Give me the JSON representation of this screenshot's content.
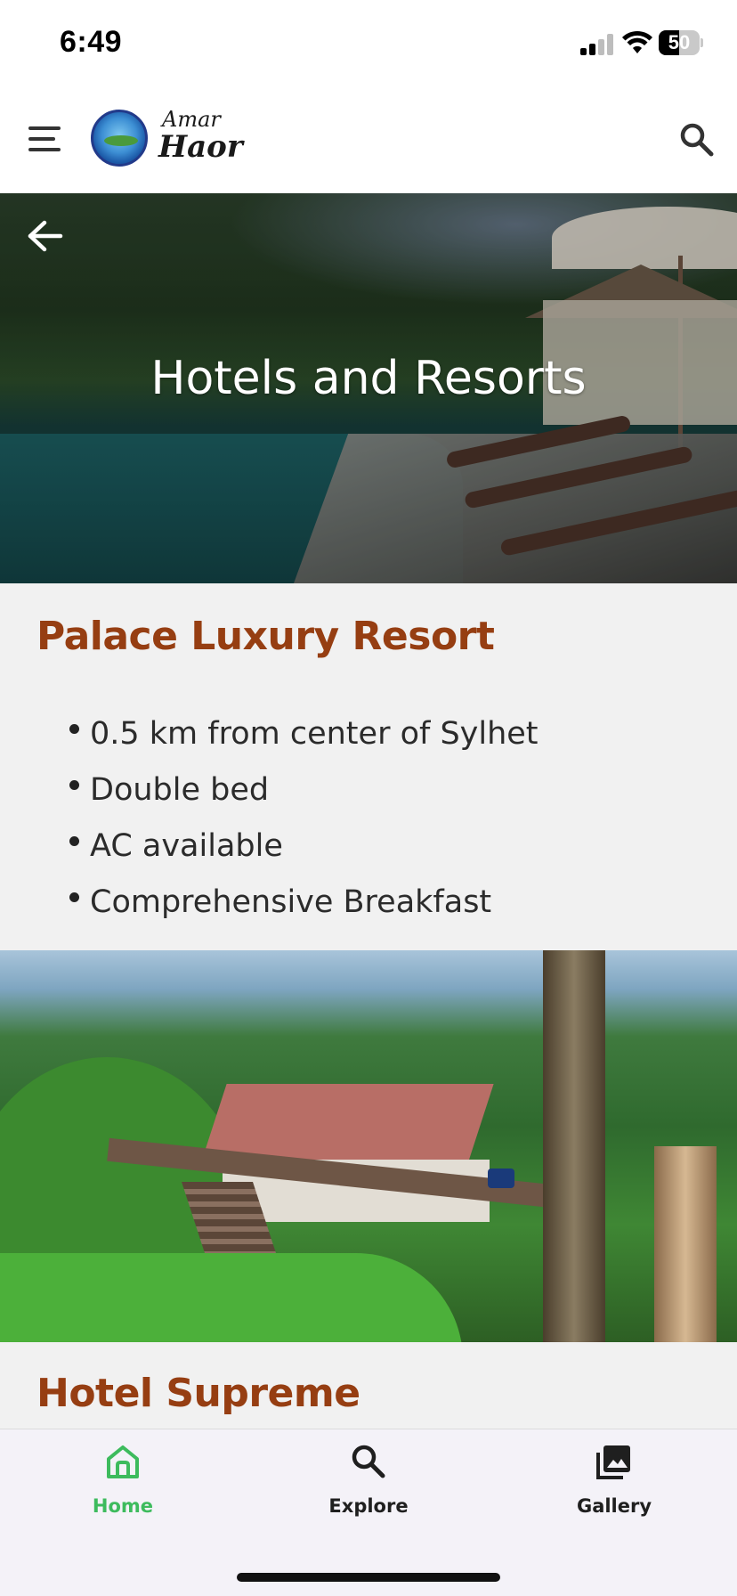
{
  "status_bar": {
    "time": "6:49",
    "battery_level": "50",
    "battery_fraction": 0.5
  },
  "header": {
    "logo_line1": "Amar",
    "logo_line2": "Haor"
  },
  "hero": {
    "title": "Hotels and Resorts"
  },
  "listings": [
    {
      "name": "Palace Luxury Resort",
      "features": [
        "0.5 km from center of Sylhet",
        "Double bed",
        "AC available",
        "Comprehensive Breakfast"
      ]
    },
    {
      "name": "Hotel Supreme"
    }
  ],
  "bottom_nav": {
    "items": [
      {
        "label": "Home",
        "icon": "home-icon",
        "active": true
      },
      {
        "label": "Explore",
        "icon": "search-icon",
        "active": false
      },
      {
        "label": "Gallery",
        "icon": "gallery-icon",
        "active": false
      }
    ]
  },
  "colors": {
    "title_accent": "#963e12",
    "active_nav": "#3dbb5d",
    "card_background": "#f1f1f1"
  }
}
